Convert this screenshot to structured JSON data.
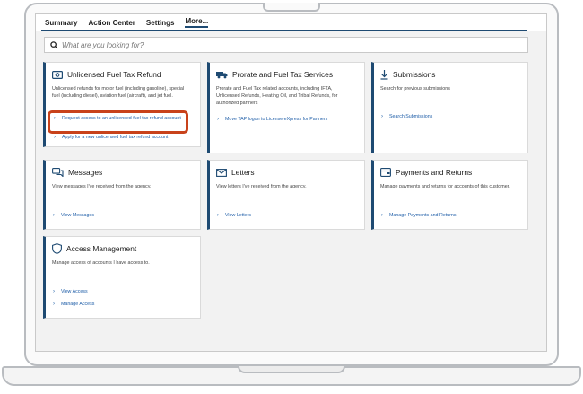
{
  "nav": {
    "tabs": [
      {
        "label": "Summary"
      },
      {
        "label": "Action Center"
      },
      {
        "label": "Settings"
      },
      {
        "label": "More..."
      }
    ]
  },
  "search": {
    "placeholder": "What are you looking for?"
  },
  "cards": {
    "fuel_refund": {
      "title": "Unlicensed Fuel Tax Refund",
      "description": "Unlicensed refunds for motor fuel (including gasoline), special fuel (including diesel), aviation fuel (aircraft), and jet fuel.",
      "links": [
        "Request access to an unlicensed fuel tax refund account",
        "Apply for a new unlicensed fuel tax refund account"
      ]
    },
    "prorate": {
      "title": "Prorate and Fuel Tax Services",
      "description": "Prorate and Fuel Tax related accounts, including IFTA, Unlicensed Refunds, Heating Oil, and Tribal Refunds, for authorized partners",
      "links": [
        "Move TAP logon to License eXpress for Partners"
      ]
    },
    "submissions": {
      "title": "Submissions",
      "description": "Search for previous submissions",
      "links": [
        "Search Submissions"
      ]
    },
    "messages": {
      "title": "Messages",
      "description": "View messages I've received from the agency.",
      "links": [
        "View Messages"
      ]
    },
    "letters": {
      "title": "Letters",
      "description": "View letters I've received from the agency.",
      "links": [
        "View Letters"
      ]
    },
    "payments": {
      "title": "Payments and Returns",
      "description": "Manage payments and returns for accounts of this customer.",
      "links": [
        "Manage Payments and Returns"
      ]
    },
    "access": {
      "title": "Access Management",
      "description": "Manage access of accounts I have access to.",
      "links": [
        "View Access",
        "Manage Access"
      ]
    }
  },
  "colors": {
    "accent": "#1e4a72",
    "link": "#1f5ea8",
    "highlight": "#c8421b"
  },
  "icons": {
    "fuel_refund": "money-icon",
    "prorate": "truck-icon",
    "submissions": "download-icon",
    "messages": "chat-icon",
    "letters": "envelope-icon",
    "payments": "wallet-icon",
    "access": "shield-icon"
  }
}
